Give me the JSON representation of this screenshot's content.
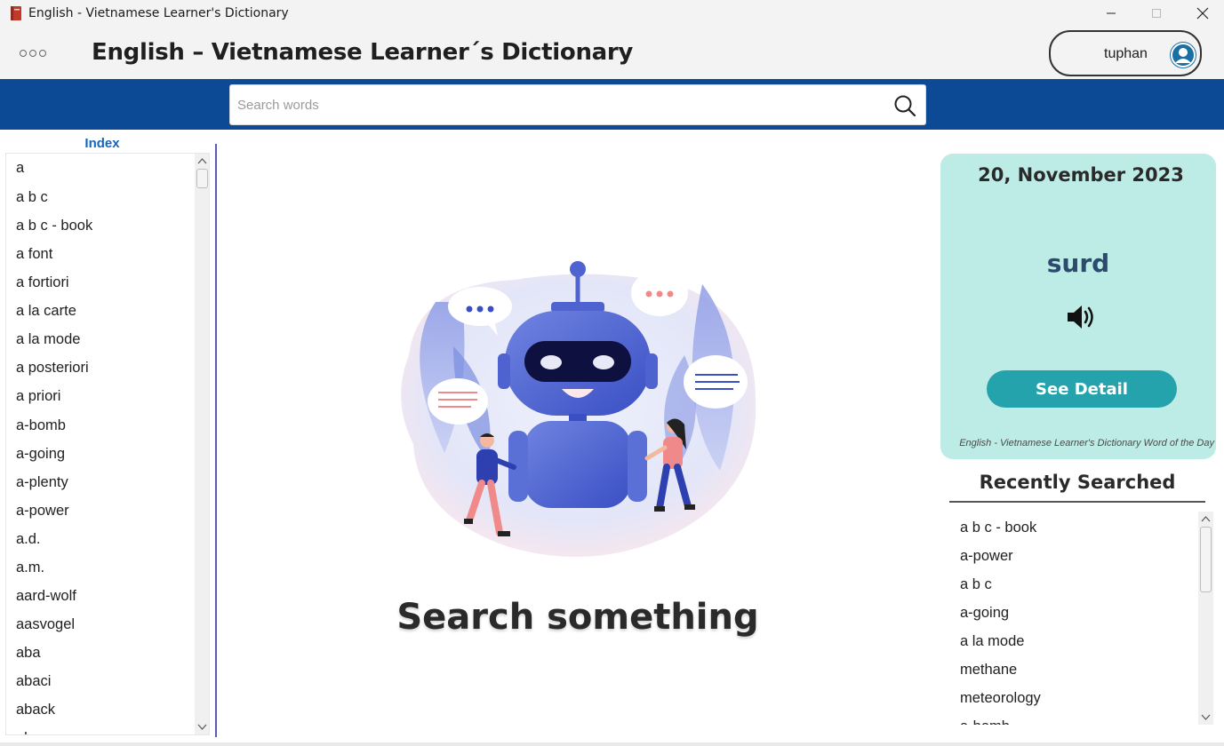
{
  "window": {
    "title": "English - Vietnamese Learner's Dictionary"
  },
  "header": {
    "title": "English – Vietnamese Learner´s Dictionary",
    "username": "tuphan"
  },
  "search": {
    "placeholder": "Search words"
  },
  "index": {
    "title": "Index",
    "items": [
      "a",
      "a b c",
      "a b c - book",
      "a font",
      "a fortiori",
      "a la carte",
      "a la mode",
      "a posteriori",
      "a priori",
      "a-bomb",
      "a-going",
      "a-plenty",
      "a-power",
      "a.d.",
      "a.m.",
      "aard-wolf",
      "aasvogel",
      "aba",
      "abaci",
      "aback",
      "abacus"
    ]
  },
  "main": {
    "empty_state_title": "Search something"
  },
  "word_of_the_day": {
    "date": "20, November 2023",
    "word": "surd",
    "button_label": "See Detail",
    "caption": "English - Vietnamese Learner's Dictionary Word of the Day"
  },
  "recent": {
    "title": "Recently Searched",
    "items": [
      "a b c - book",
      "a-power",
      "a b c",
      "a-going",
      "a la mode",
      "methane",
      "meteorology",
      "a-bomb"
    ]
  },
  "colors": {
    "brand_blue": "#0d4a96",
    "index_title": "#1565c0",
    "card_bg": "#bdebe6",
    "button_teal": "#25a3ac",
    "word_color": "#2d4a6e"
  }
}
